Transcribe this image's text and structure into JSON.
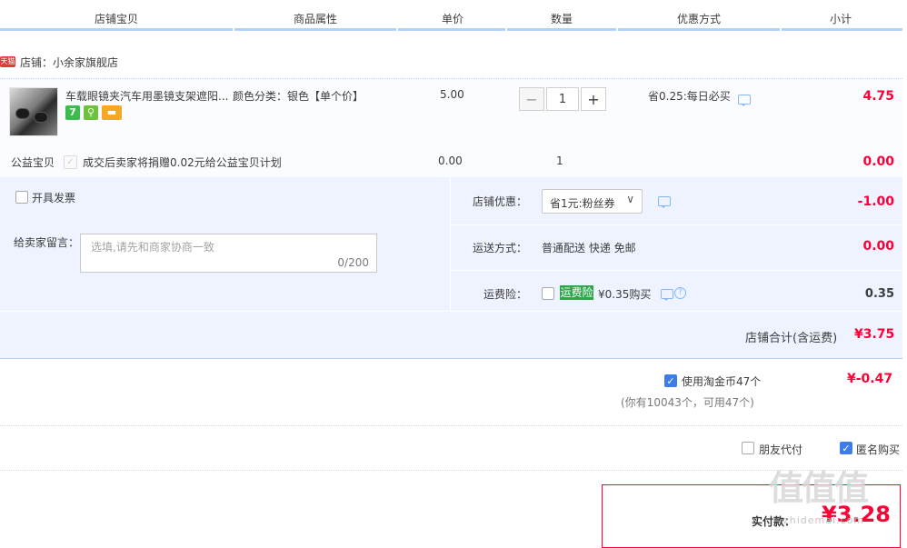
{
  "header": {
    "col_shop_item": "店铺宝贝",
    "col_properties": "商品属性",
    "col_unit_price": "单价",
    "col_quantity": "数量",
    "col_discount": "优惠方式",
    "col_subtotal": "小计"
  },
  "shop": {
    "badge": "天猫",
    "name": "店铺：小余家旗舰店"
  },
  "item": {
    "title": "车载眼镜夹汽车用墨镜支架遮阳...",
    "property": "颜色分类：银色【单个价】",
    "unit_price": "5.00",
    "qty_minus": "−",
    "quantity": "1",
    "qty_plus": "+",
    "promo": "省0.25:每日必买",
    "subtotal": "4.75",
    "service_icons": [
      "7",
      "⚲",
      "▬"
    ]
  },
  "charity": {
    "label": "公益宝贝",
    "text": "成交后卖家将捐赠0.02元给公益宝贝计划",
    "unit_price": "0.00",
    "quantity": "1",
    "subtotal": "0.00"
  },
  "options": {
    "invoice_label": "开具发票",
    "remark_label": "给卖家留言：",
    "remark_placeholder": "选填,请先和商家协商一致",
    "remark_count": "0/200",
    "shop_coupon_label": "店铺优惠：",
    "shop_coupon_value": "省1元:粉丝券",
    "shop_coupon_amount": "-1.00",
    "shipping_label": "运送方式：",
    "shipping_value": "普通配送 快递 免邮",
    "shipping_amount": "0.00",
    "insurance_label": "运费险：",
    "insurance_badge": "运费险",
    "insurance_text": "¥0.35购买",
    "insurance_amount": "0.35"
  },
  "shop_total": {
    "label": "店铺合计(含运费)",
    "value": "¥3.75"
  },
  "coins": {
    "text": "使用淘金币47个",
    "sub": "(你有10043个，可用47个)",
    "amount": "¥-0.47"
  },
  "extras": {
    "friend_pay": "朋友代付",
    "anonymous": "匿名购买"
  },
  "payment": {
    "label": "实付款：",
    "amount": "¥3.28"
  },
  "watermark": {
    "text": "值值值",
    "sub": "zhidemai.com"
  },
  "colors": {
    "accent_red": "#ff0036",
    "accent_blue": "#3e7ce8",
    "header_line": "#b2d1ff",
    "panel_bg": "#eef3ff",
    "insurance_green": "#2da64a"
  }
}
